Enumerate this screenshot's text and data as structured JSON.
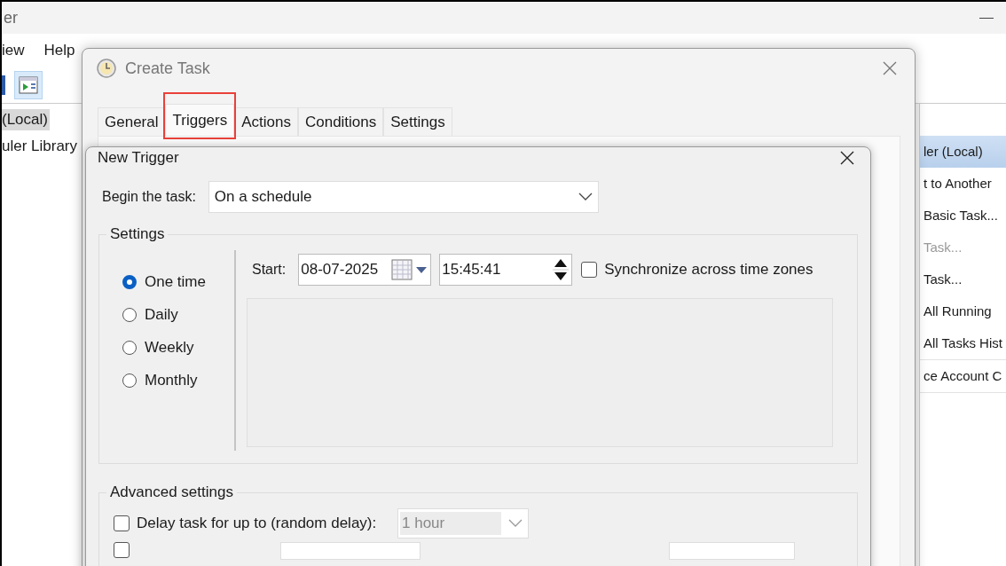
{
  "background_window": {
    "title": "er",
    "menu": [
      {
        "label": "iew"
      },
      {
        "label": "Help"
      }
    ],
    "tree": [
      {
        "label": "(Local)",
        "selected": true
      },
      {
        "label": "uler Library",
        "selected": false
      }
    ],
    "actions": [
      {
        "label": "ler (Local)",
        "kind": "header",
        "disabled": false
      },
      {
        "label": "t to Another",
        "kind": "item",
        "disabled": false
      },
      {
        "label": "Basic Task...",
        "kind": "item",
        "disabled": false
      },
      {
        "label": "Task...",
        "kind": "item",
        "disabled": true
      },
      {
        "label": "Task...",
        "kind": "item",
        "disabled": false
      },
      {
        "label": "All Running",
        "kind": "item",
        "disabled": false
      },
      {
        "label": "All Tasks Hist",
        "kind": "item",
        "disabled": false
      },
      {
        "label": "ce Account C",
        "kind": "separated",
        "disabled": false
      }
    ]
  },
  "create_task": {
    "title": "Create Task",
    "tabs": [
      {
        "label": "General",
        "selected": false,
        "annotated": false
      },
      {
        "label": "Triggers",
        "selected": true,
        "annotated": true
      },
      {
        "label": "Actions",
        "selected": false,
        "annotated": false
      },
      {
        "label": "Conditions",
        "selected": false,
        "annotated": false
      },
      {
        "label": "Settings",
        "selected": false,
        "annotated": false
      }
    ]
  },
  "new_trigger": {
    "title": "New Trigger",
    "begin_label": "Begin the task:",
    "begin_value": "On a schedule",
    "settings": {
      "title": "Settings",
      "schedules": [
        {
          "label": "One time",
          "selected": true
        },
        {
          "label": "Daily",
          "selected": false
        },
        {
          "label": "Weekly",
          "selected": false
        },
        {
          "label": "Monthly",
          "selected": false
        }
      ],
      "start_label": "Start:",
      "date": "08-07-2025",
      "time": "15:45:41",
      "sync": {
        "label": "Synchronize across time zones",
        "checked": false
      }
    },
    "advanced": {
      "title": "Advanced settings",
      "delay": {
        "label": "Delay task for up to (random delay):",
        "checked": false,
        "value": "1 hour",
        "disabled": true
      },
      "row_2": {
        "checked": false
      }
    }
  }
}
